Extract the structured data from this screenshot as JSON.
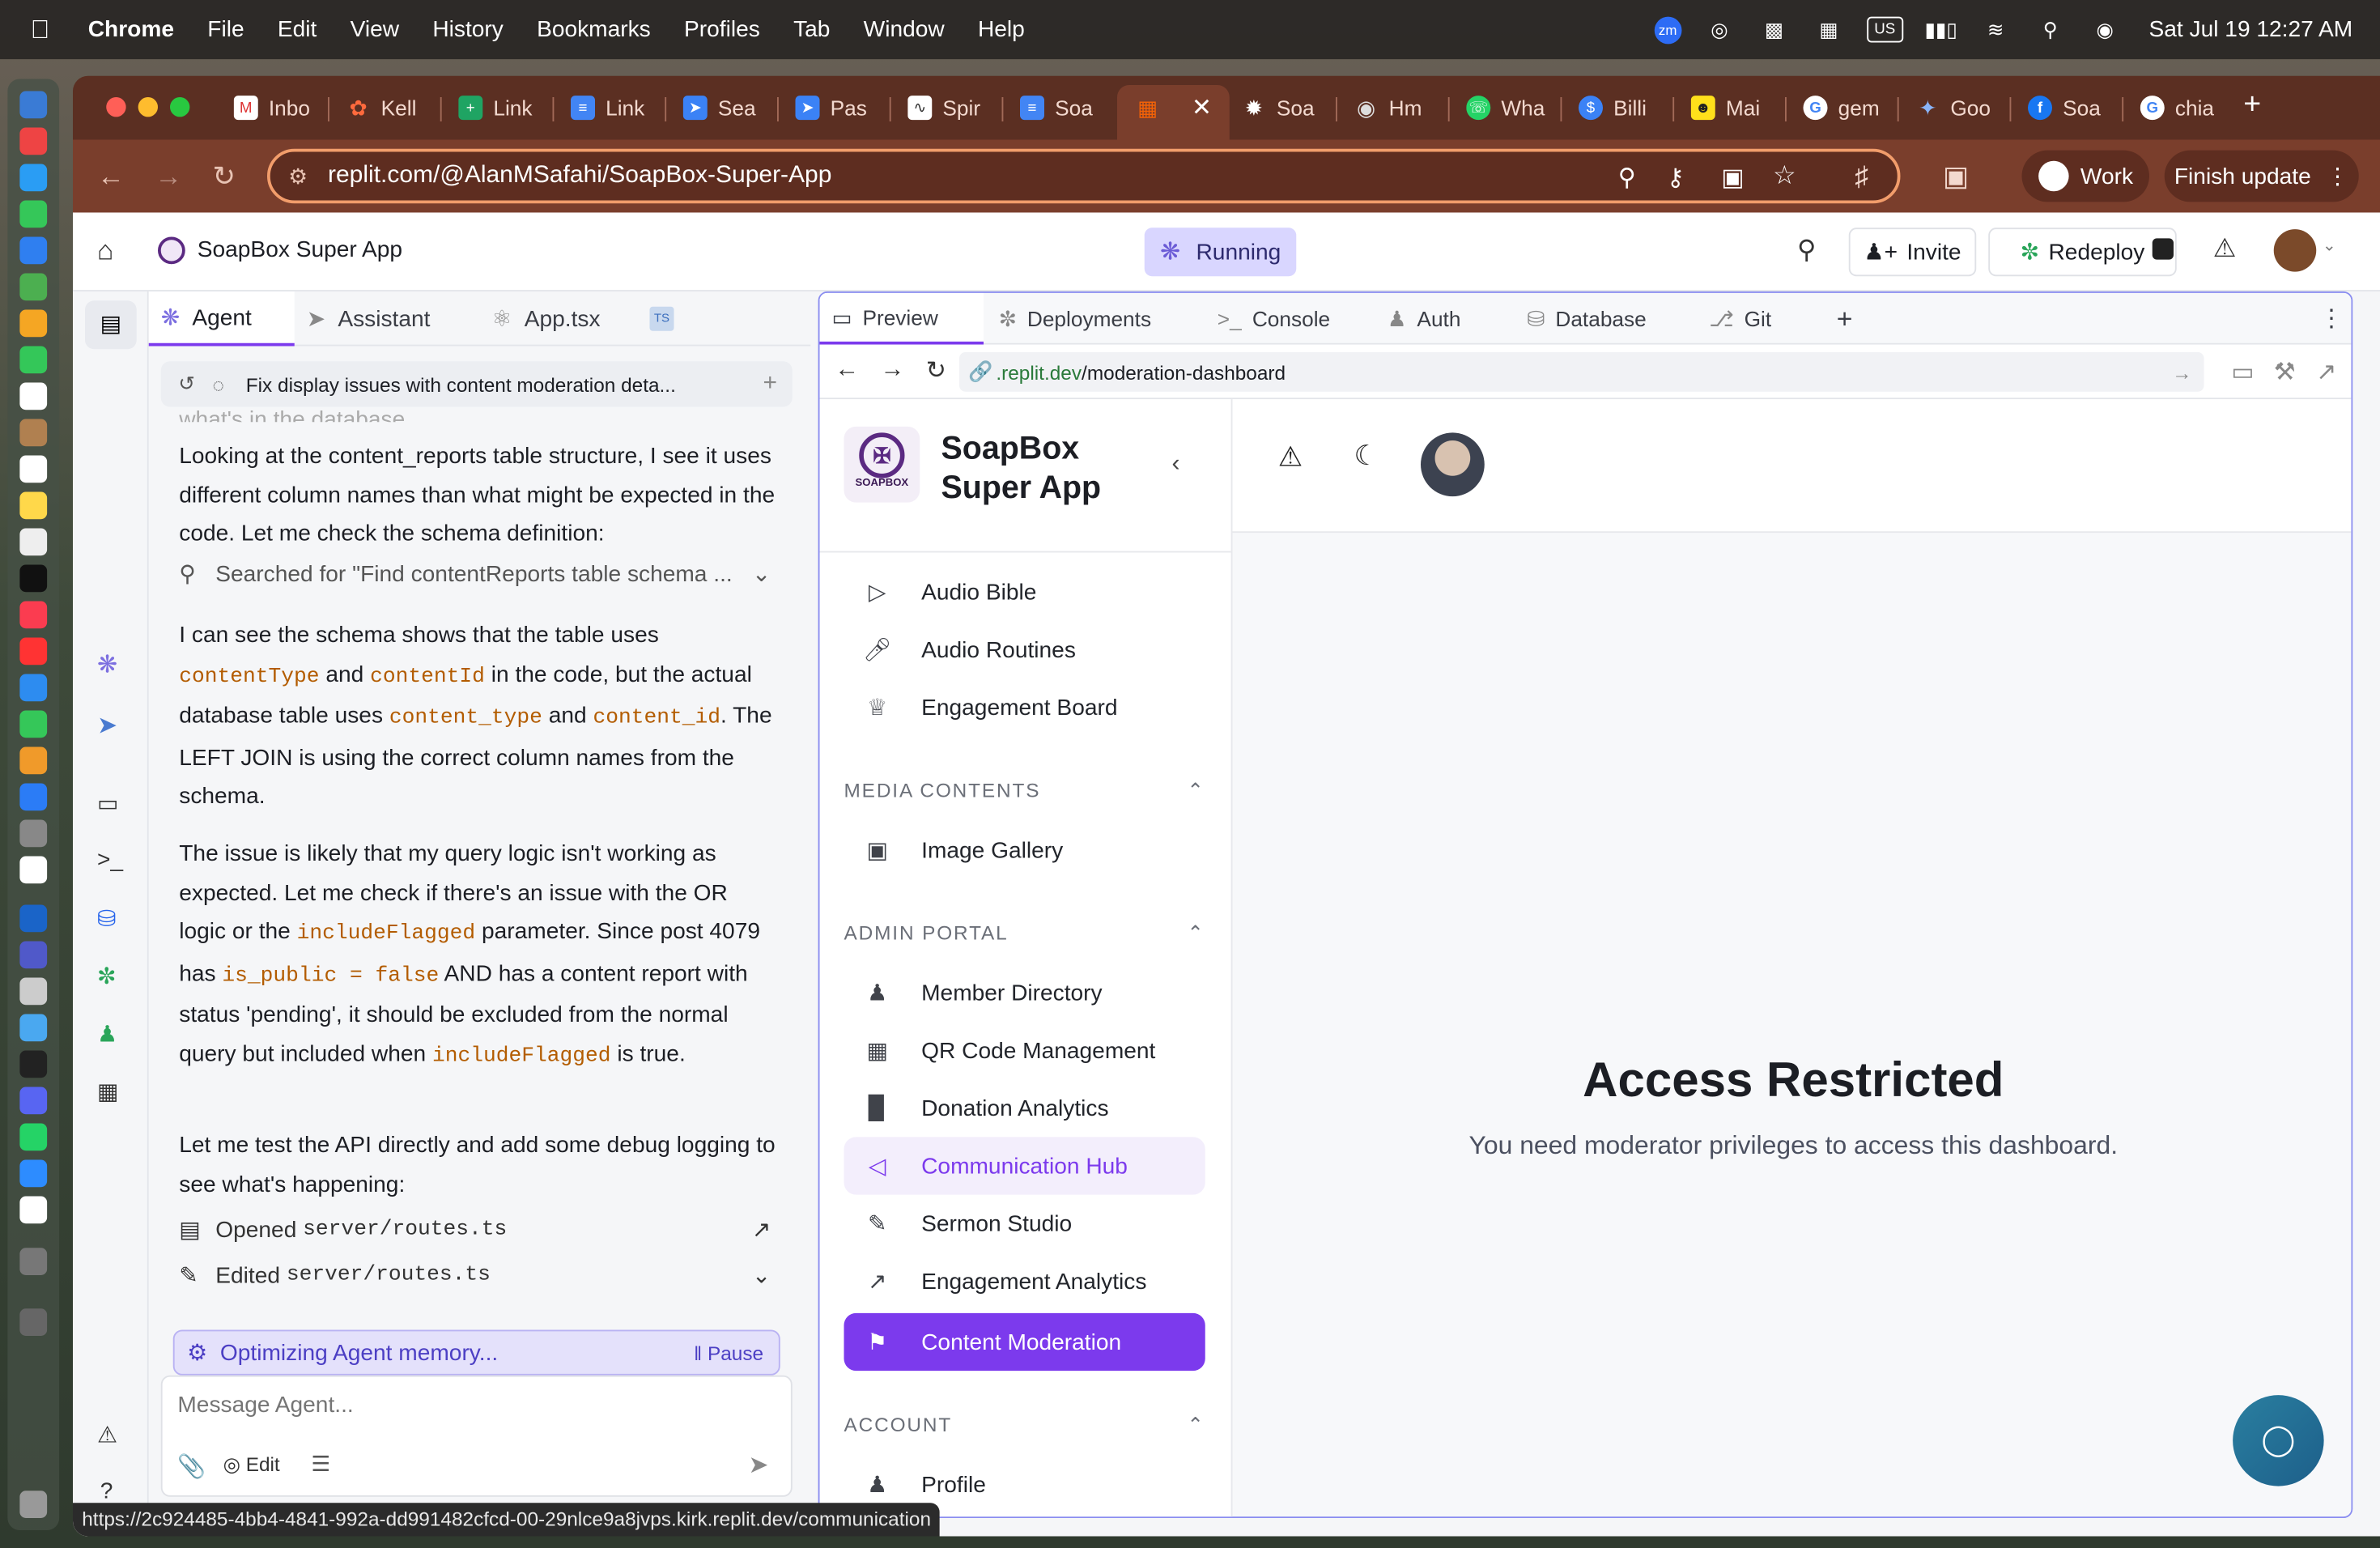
{
  "menubar": {
    "app": "Chrome",
    "items": [
      "File",
      "Edit",
      "View",
      "History",
      "Bookmarks",
      "Profiles",
      "Tab",
      "Window",
      "Help"
    ],
    "datetime": "Sat Jul 19  12:27 AM",
    "input_source": "US",
    "zoom": "zm"
  },
  "tabs": [
    "Inbo",
    "Kell",
    "Link",
    "Link",
    "Sea",
    "Pas",
    "Spir",
    "Soa",
    "",
    "Soa",
    "Hm",
    "Wha",
    "Billi",
    "Mai",
    "gem",
    "Goo",
    "Soa",
    "chia"
  ],
  "address": {
    "url": "replit.com/@AlanMSafahi/SoapBox-Super-App"
  },
  "toolbar": {
    "work": "Work",
    "finish": "Finish update"
  },
  "replit": {
    "project": "SoapBox Super App",
    "status": "Running",
    "invite": "Invite",
    "redeploy": "Redeploy"
  },
  "agent": {
    "tabs": [
      "Agent",
      "Assistant",
      "App.tsx"
    ],
    "thread_title": "Fix display issues with content moderation deta...",
    "faded": "what's in the database.",
    "p1": "Looking at the content_reports table structure, I see it uses different column names than what might be expected in the code. Let me check the schema definition:",
    "search": "Searched for \"Find contentReports table schema ...",
    "p2a": "I can see the schema shows that the table uses",
    "c1": "contentType",
    "and1": "and",
    "c2": "contentId",
    "p2b": "in the code, but the actual database table uses",
    "c3": "content_type",
    "and2": "and",
    "c4": "content_id",
    "p2c": ". The LEFT JOIN is using the correct column names from the schema.",
    "p3a": "The issue is likely that my query logic isn't working as expected. Let me check if there's an issue with the OR logic or the",
    "c5": "includeFlagged",
    "p3b": "parameter. Since post 4079 has",
    "c6": "is_public = false",
    "p3c": "AND has a content report with status 'pending', it should be excluded from the normal query but included when",
    "c7": "includeFlagged",
    "p3d": "is true.",
    "p4": "Let me test the API directly and add some debug logging to see what's happening:",
    "opened": "Opened",
    "opened_file": "server/routes.ts",
    "edited": "Edited",
    "edited_file": "server/routes.ts",
    "optimizing": "Optimizing Agent memory...",
    "pause": "Pause",
    "placeholder": "Message Agent...",
    "edit": "Edit"
  },
  "preview": {
    "tabs": [
      "Preview",
      "Deployments",
      "Console",
      "Auth",
      "Database",
      "Git"
    ],
    "url_host": ".replit.dev",
    "url_path": "/moderation-dashboard",
    "app_name_1": "SoapBox",
    "app_name_2": "Super App",
    "logo_text": "SOAPBOX",
    "nav_top": [
      "Audio Bible",
      "Audio Routines",
      "Engagement Board"
    ],
    "section_media": "MEDIA CONTENTS",
    "nav_media": [
      "Image Gallery"
    ],
    "section_admin": "ADMIN PORTAL",
    "nav_admin": [
      "Member Directory",
      "QR Code Management",
      "Donation Analytics",
      "Communication Hub",
      "Sermon Studio",
      "Engagement Analytics",
      "Content Moderation"
    ],
    "section_account": "ACCOUNT",
    "nav_account": [
      "Profile"
    ],
    "heading": "Access Restricted",
    "message": "You need moderator privileges to access this dashboard."
  },
  "statusbar": {
    "link": "https://2c924485-4bb4-4841-992a-dd991482cfcd-00-29nlce9a8jvps.kirk.replit.dev/communication"
  },
  "colors": {
    "accent": "#7c3aed",
    "browser": "#7a3e2c",
    "omnibox_border": "#f29d6b"
  }
}
